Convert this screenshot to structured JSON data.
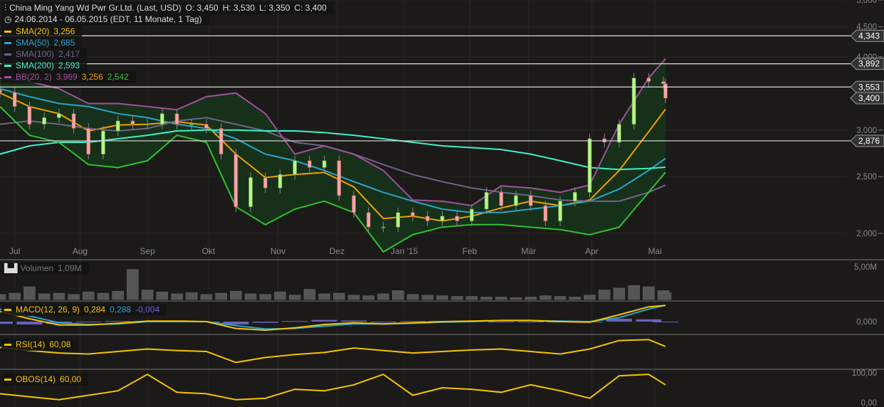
{
  "header": {
    "title": "China Ming Yang Wd Pwr Gr.Ltd. (Last, USD)",
    "open": "O: 3,450",
    "high": "H: 3,530",
    "low": "L: 3,350",
    "close": "C: 3,400",
    "range": "24.06.2014 - 06.05.2015 (EDT, 11 Monate, 1 Tag)",
    "chart_icon": "candlestick-icon",
    "clock_icon": "clock-icon"
  },
  "legend": {
    "sma20": {
      "label": "SMA(20)",
      "value": "3,256",
      "color": "#f5c400"
    },
    "sma50": {
      "label": "SMA(50)",
      "value": "2,685",
      "color": "#2aa3cc"
    },
    "sma100": {
      "label": "SMA(100)",
      "value": "2,417",
      "color": "#6e6488"
    },
    "sma200": {
      "label": "SMA(200)",
      "value": "2,593",
      "color": "#3ef0c8"
    },
    "bb": {
      "label": "BB(20, 2)",
      "upper": "3,969",
      "middle": "3,256",
      "lower": "2,542",
      "color": "#a0509a",
      "middle_color": "#f0a000",
      "lower_color": "#30c030"
    },
    "volume": {
      "label": "Volumen",
      "value": "1,09M",
      "icon": "volume-bars-icon"
    },
    "macd": {
      "label": "MACD(12, 26, 9)",
      "macd": "0,284",
      "signal": "0,288",
      "hist": "-0,004"
    },
    "rsi": {
      "label": "RSI(14)",
      "value": "60,08"
    },
    "obos": {
      "label": "OBOS(14)",
      "value": "60,00"
    }
  },
  "price_axis": [
    "5,000",
    "4,500",
    "4,000",
    "3,000",
    "2,500",
    "2,000"
  ],
  "price_axis_values": [
    5000,
    4500,
    4000,
    3000,
    2500,
    2000
  ],
  "markers": [
    {
      "label": "4,343",
      "value": 4343,
      "line": true
    },
    {
      "label": "3,892",
      "value": 3892,
      "line": true
    },
    {
      "label": "3,553",
      "value": 3553,
      "line": true
    },
    {
      "label": "3,400",
      "value": 3400,
      "line": false
    },
    {
      "label": "2,876",
      "value": 2876,
      "line": true
    }
  ],
  "x_labels": [
    {
      "label": "Jul",
      "date": "2014-07-01"
    },
    {
      "label": "Aug",
      "date": "2014-08-01"
    },
    {
      "label": "Sep",
      "date": "2014-09-02"
    },
    {
      "label": "Okt",
      "date": "2014-10-01"
    },
    {
      "label": "Nov",
      "date": "2014-11-03"
    },
    {
      "label": "Dez",
      "date": "2014-12-01"
    },
    {
      "label": "Jan '15",
      "date": "2015-01-02"
    },
    {
      "label": "Feb",
      "date": "2015-02-02"
    },
    {
      "label": "Mär",
      "date": "2015-03-02"
    },
    {
      "label": "Apr",
      "date": "2015-04-01"
    },
    {
      "label": "Mai",
      "date": "2015-05-01"
    }
  ],
  "lower_axes": {
    "volume_max": "5,00M",
    "macd_zero": "0,000",
    "obos_max": "100,00",
    "obos_min": "0,00"
  },
  "chart_data": {
    "type": "candlestick",
    "scale": "log",
    "ylim": [
      2000,
      5000
    ],
    "grid": true,
    "candle_dates": [
      "2014-06-24",
      "2014-07-01",
      "2014-07-08",
      "2014-07-15",
      "2014-07-22",
      "2014-07-29",
      "2014-08-05",
      "2014-08-12",
      "2014-08-19",
      "2014-08-26",
      "2014-09-02",
      "2014-09-09",
      "2014-09-16",
      "2014-09-23",
      "2014-09-30",
      "2014-10-07",
      "2014-10-14",
      "2014-10-21",
      "2014-10-28",
      "2014-11-04",
      "2014-11-11",
      "2014-11-18",
      "2014-11-25",
      "2014-12-02",
      "2014-12-09",
      "2014-12-16",
      "2014-12-23",
      "2014-12-30",
      "2015-01-06",
      "2015-01-13",
      "2015-01-20",
      "2015-01-27",
      "2015-02-03",
      "2015-02-10",
      "2015-02-17",
      "2015-02-24",
      "2015-03-03",
      "2015-03-10",
      "2015-03-17",
      "2015-03-24",
      "2015-03-31",
      "2015-04-07",
      "2015-04-14",
      "2015-04-21",
      "2015-04-28",
      "2015-05-05",
      "2015-05-06"
    ],
    "closes": [
      3478,
      3290,
      3070,
      3150,
      3200,
      3020,
      2730,
      2990,
      3110,
      3070,
      3070,
      3200,
      3070,
      3070,
      3020,
      2730,
      2220,
      2490,
      2390,
      2520,
      2660,
      2590,
      2660,
      2320,
      2170,
      2050,
      2050,
      2170,
      2140,
      2100,
      2140,
      2100,
      2200,
      2350,
      2230,
      2320,
      2230,
      2100,
      2270,
      2350,
      2900,
      2860,
      3070,
      3680,
      3630,
      3600,
      3400
    ],
    "volume_millions": [
      0.8,
      1.0,
      2.0,
      0.9,
      1.0,
      0.8,
      1.2,
      1.0,
      1.3,
      4.7,
      1.5,
      1.2,
      0.9,
      1.1,
      0.8,
      1.0,
      1.3,
      0.9,
      0.8,
      1.2,
      0.7,
      1.6,
      0.9,
      1.0,
      0.7,
      0.6,
      0.9,
      1.4,
      0.8,
      0.7,
      0.6,
      0.5,
      0.5,
      0.4,
      0.4,
      0.3,
      0.4,
      0.6,
      0.5,
      0.4,
      0.7,
      1.5,
      1.8,
      2.2,
      2.0,
      1.4,
      1.09
    ],
    "line_dates": [
      "2014-06-24",
      "2014-07-08",
      "2014-07-22",
      "2014-08-05",
      "2014-08-19",
      "2014-09-02",
      "2014-09-16",
      "2014-09-30",
      "2014-10-14",
      "2014-10-28",
      "2014-11-11",
      "2014-11-25",
      "2014-12-09",
      "2014-12-23",
      "2015-01-06",
      "2015-01-20",
      "2015-02-03",
      "2015-02-17",
      "2015-03-03",
      "2015-03-17",
      "2015-03-31",
      "2015-04-14",
      "2015-04-28",
      "2015-05-06"
    ],
    "series": [
      {
        "name": "SMA(20)",
        "color": "#f0a000",
        "values": [
          3470,
          3290,
          3200,
          2990,
          3060,
          3070,
          3100,
          3060,
          2730,
          2490,
          2520,
          2540,
          2400,
          2120,
          2140,
          2100,
          2140,
          2210,
          2270,
          2230,
          2280,
          2560,
          2980,
          3256
        ]
      },
      {
        "name": "SMA(50)",
        "color": "#2aa3cc",
        "values": [
          3530,
          3420,
          3330,
          3290,
          3200,
          3150,
          3070,
          3020,
          2900,
          2730,
          2660,
          2560,
          2450,
          2350,
          2270,
          2200,
          2170,
          2170,
          2200,
          2230,
          2270,
          2380,
          2560,
          2685
        ]
      },
      {
        "name": "SMA(100)",
        "color": "#6e6488",
        "values": [
          3070,
          3110,
          3070,
          3020,
          2990,
          3020,
          3110,
          3150,
          3070,
          2990,
          2860,
          2820,
          2730,
          2620,
          2520,
          2450,
          2390,
          2350,
          2320,
          2280,
          2270,
          2270,
          2350,
          2417
        ]
      },
      {
        "name": "SMA(200)",
        "color": "#3ef0c8",
        "values": [
          2730,
          2820,
          2860,
          2860,
          2900,
          2940,
          2990,
          3000,
          3000,
          2990,
          2990,
          2970,
          2940,
          2900,
          2860,
          2820,
          2800,
          2780,
          2730,
          2660,
          2590,
          2570,
          2580,
          2593
        ]
      },
      {
        "name": "BB upper",
        "color": "#a0509a",
        "values": [
          3680,
          3630,
          3530,
          3330,
          3330,
          3290,
          3250,
          3420,
          3470,
          3200,
          2730,
          2820,
          2730,
          2560,
          2280,
          2270,
          2230,
          2410,
          2390,
          2350,
          2420,
          3070,
          3680,
          3969
        ]
      },
      {
        "name": "BB lower",
        "color": "#30c030",
        "values": [
          3290,
          2940,
          2860,
          2620,
          2590,
          2660,
          2940,
          2860,
          2220,
          2070,
          2200,
          2270,
          2170,
          1860,
          1990,
          2050,
          2070,
          2070,
          2050,
          2030,
          1990,
          2050,
          2350,
          2542
        ]
      }
    ],
    "macd": {
      "macd": [
        0.18,
        0.05,
        -0.06,
        -0.06,
        -0.03,
        0.01,
        0.01,
        0.0,
        -0.12,
        -0.15,
        -0.11,
        -0.05,
        -0.02,
        -0.04,
        -0.02,
        0.0,
        0.01,
        0.02,
        0.02,
        0.0,
        -0.01,
        0.12,
        0.26,
        0.284
      ],
      "signal": [
        0.22,
        0.1,
        -0.02,
        -0.05,
        -0.04,
        0.0,
        0.0,
        0.0,
        -0.07,
        -0.13,
        -0.12,
        -0.08,
        -0.04,
        -0.04,
        -0.03,
        -0.01,
        0.0,
        0.02,
        0.02,
        0.01,
        0.0,
        0.07,
        0.22,
        0.288
      ]
    },
    "rsi": [
      58,
      52,
      47,
      45,
      50,
      55,
      52,
      50,
      28,
      38,
      44,
      48,
      57,
      52,
      47,
      50,
      53,
      55,
      50,
      45,
      55,
      72,
      74,
      60.08
    ],
    "obos": [
      30,
      20,
      10,
      25,
      40,
      95,
      35,
      30,
      10,
      15,
      45,
      40,
      60,
      95,
      25,
      50,
      45,
      35,
      60,
      40,
      15,
      90,
      95,
      60
    ]
  }
}
